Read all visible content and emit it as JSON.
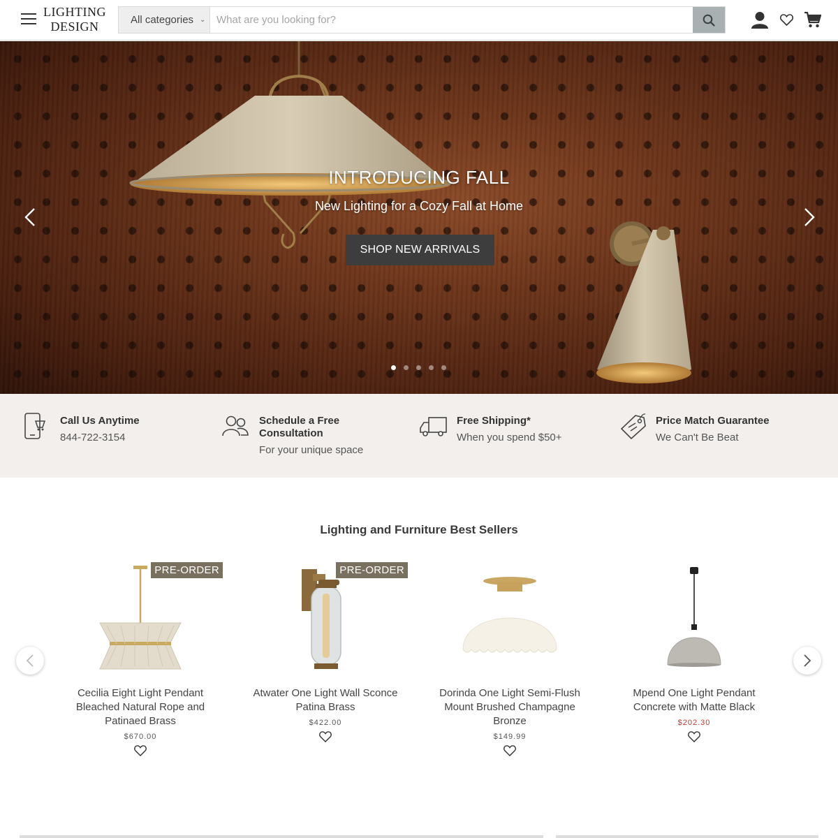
{
  "header": {
    "logo_line1": "LIGHTING",
    "logo_line2": "DESIGN",
    "category_label": "All categories",
    "search_placeholder": "What are you looking for?",
    "icons": [
      "menu-icon",
      "search-icon",
      "account-icon",
      "heart-icon",
      "cart-icon"
    ]
  },
  "hero": {
    "title": "INTRODUCING FALL",
    "subtitle": "New Lighting for a Cozy Fall at Home",
    "cta": "SHOP NEW ARRIVALS",
    "slide_count": 5,
    "active_slide": 1
  },
  "features": [
    {
      "icon": "phone-icon",
      "title": "Call Us Anytime",
      "subtitle": "844-722-3154"
    },
    {
      "icon": "users-icon",
      "title_line1": "Schedule a Free",
      "title_line2": "Consultation",
      "subtitle": "For your unique space"
    },
    {
      "icon": "truck-icon",
      "title": "Free Shipping*",
      "subtitle": "When you spend $50+"
    },
    {
      "icon": "tag-icon",
      "title": "Price Match Guarantee",
      "subtitle": "We Can't Be Beat"
    }
  ],
  "best_sellers": {
    "title": "Lighting and Furniture Best Sellers",
    "products": [
      {
        "badge": "PRE-ORDER",
        "name_line1": "Cecilia Eight Light Pendant",
        "name_line2": "Bleached Natural Rope and",
        "name_line3": "Patinaed Brass",
        "price": "$670.00"
      },
      {
        "badge": "PRE-ORDER",
        "name_line1": "Atwater One Light Wall Sconce",
        "name_line2": "Patina Brass",
        "price": "$422.00"
      },
      {
        "name_line1": "Dorinda One Light Semi-Flush",
        "name_line2": "Mount Brushed Champagne",
        "name_line3": "Bronze",
        "price": "$149.99"
      },
      {
        "name_line1": "Mpend One Light Pendant",
        "name_line2": "Concrete with Matte Black",
        "price": "$202.30"
      }
    ]
  },
  "colors": {
    "cta_bg": "#3d3d3d",
    "badge_bg": "#7a705f",
    "sale_price": "#c0392b",
    "feature_bar_bg": "#f2efec",
    "search_button_bg": "#a8b0b1"
  }
}
